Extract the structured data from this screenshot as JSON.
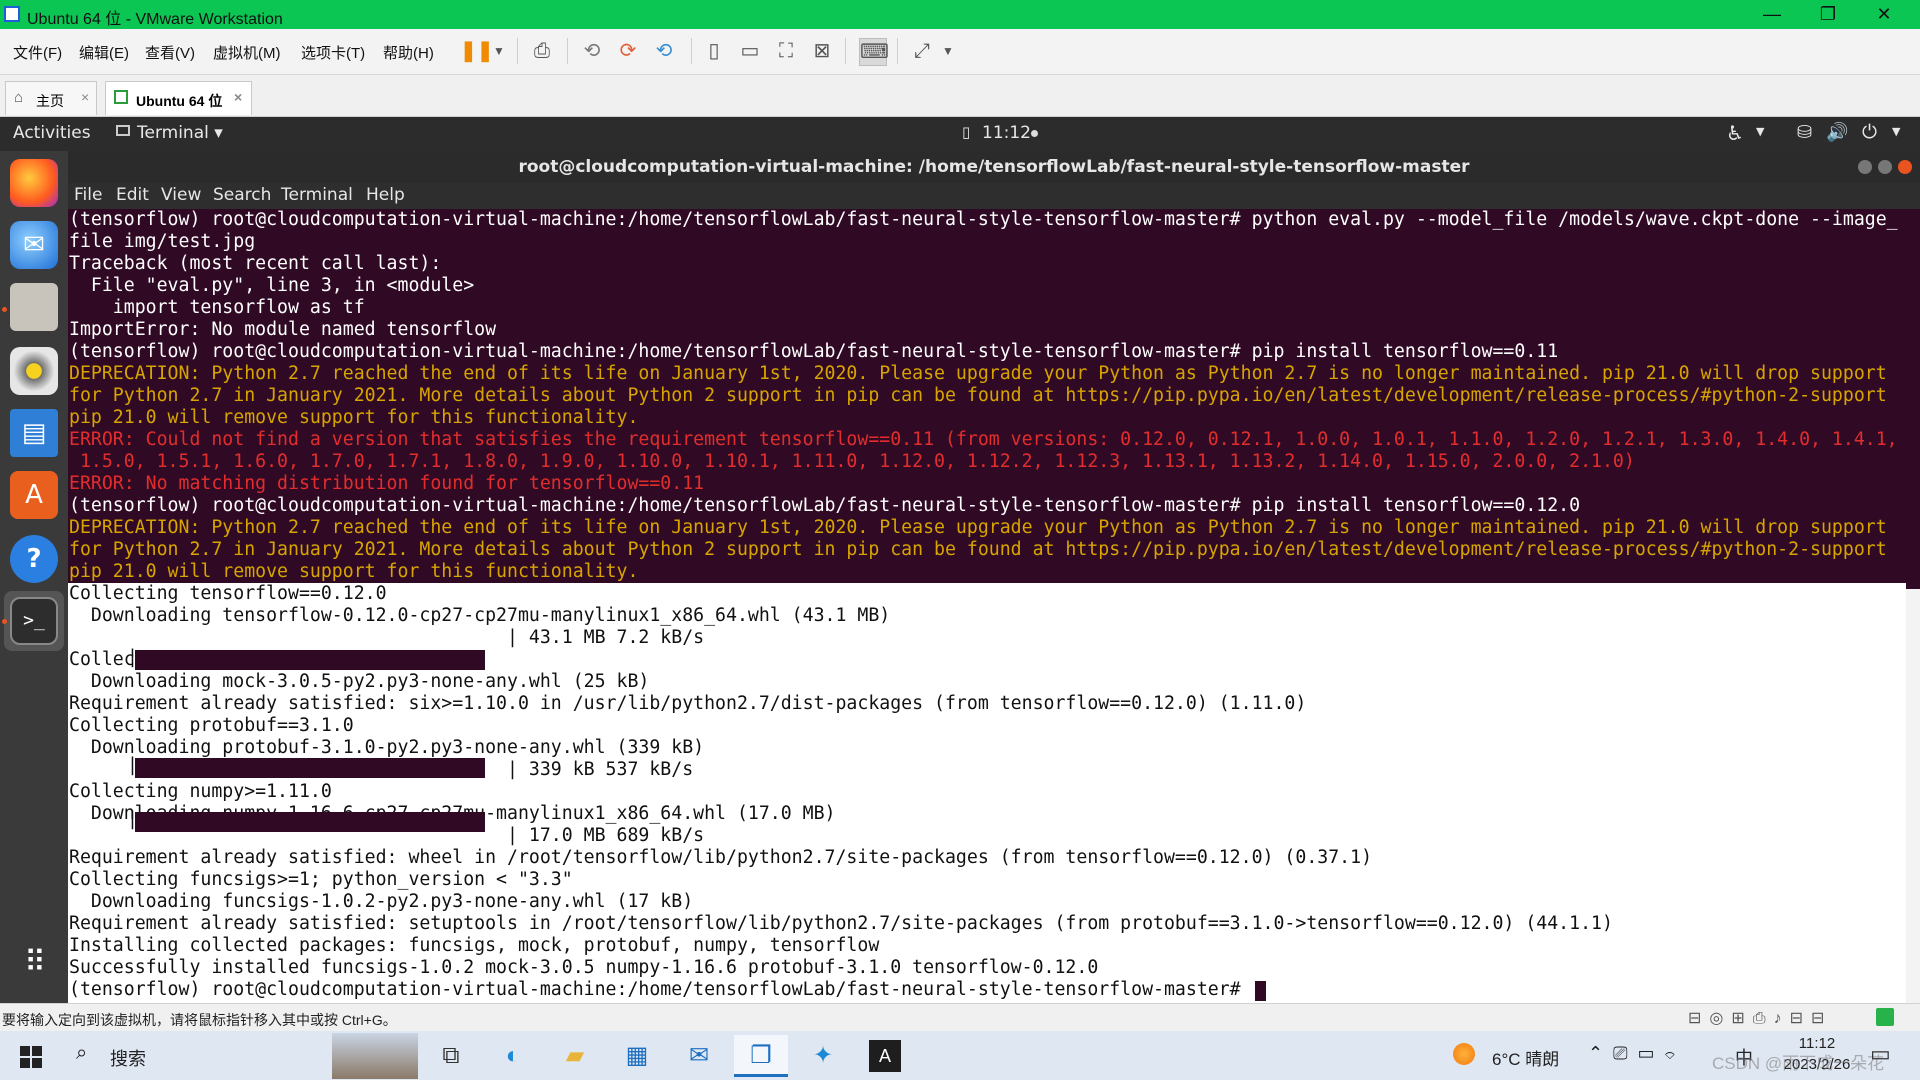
{
  "window": {
    "title": "Ubuntu 64 位 - VMware Workstation",
    "minimize": "—",
    "restore": "❐",
    "close": "✕"
  },
  "vm_menu": [
    "文件(F)",
    "编辑(E)",
    "查看(V)",
    "虚拟机(M)",
    "选项卡(T)",
    "帮助(H)"
  ],
  "vm_tabs": {
    "home": "主页",
    "vm": "Ubuntu 64 位",
    "close": "×"
  },
  "ubuntu_topbar": {
    "activities": "Activities",
    "app": "Terminal ▾",
    "clock": "11:12"
  },
  "terminal": {
    "title": "root@cloudcomputation-virtual-machine: /home/tensorflowLab/fast-neural-style-tensorflow-master",
    "menu": [
      "File",
      "Edit",
      "View",
      "Search",
      "Terminal",
      "Help"
    ],
    "lines": [
      "(tensorflow) root@cloudcomputation-virtual-machine:/home/tensorflowLab/fast-neural-style-tensorflow-master# python eval.py --model_file /models/wave.ckpt-done --image_",
      "file img/test.jpg",
      "Traceback (most recent call last):",
      "  File \"eval.py\", line 3, in <module>",
      "    import tensorflow as tf",
      "ImportError: No module named tensorflow",
      "(tensorflow) root@cloudcomputation-virtual-machine:/home/tensorflowLab/fast-neural-style-tensorflow-master# pip install tensorflow==0.11",
      "DEPRECATION: Python 2.7 reached the end of its life on January 1st, 2020. Please upgrade your Python as Python 2.7 is no longer maintained. pip 21.0 will drop support",
      "for Python 2.7 in January 2021. More details about Python 2 support in pip can be found at https://pip.pypa.io/en/latest/development/release-process/#python-2-support",
      "pip 21.0 will remove support for this functionality.",
      "ERROR: Could not find a version that satisfies the requirement tensorflow==0.11 (from versions: 0.12.0, 0.12.1, 1.0.0, 1.0.1, 1.1.0, 1.2.0, 1.2.1, 1.3.0, 1.4.0, 1.4.1,",
      " 1.5.0, 1.5.1, 1.6.0, 1.7.0, 1.7.1, 1.8.0, 1.9.0, 1.10.0, 1.10.1, 1.11.0, 1.12.0, 1.12.2, 1.12.3, 1.13.1, 1.13.2, 1.14.0, 1.15.0, 2.0.0, 2.1.0)",
      "ERROR: No matching distribution found for tensorflow==0.11",
      "(tensorflow) root@cloudcomputation-virtual-machine:/home/tensorflowLab/fast-neural-style-tensorflow-master# pip install tensorflow==0.12.0",
      "DEPRECATION: Python 2.7 reached the end of its life on January 1st, 2020. Please upgrade your Python as Python 2.7 is no longer maintained. pip 21.0 will drop support",
      "for Python 2.7 in January 2021. More details about Python 2 support in pip can be found at https://pip.pypa.io/en/latest/development/release-process/#python-2-support",
      "pip 21.0 will remove support for this functionality.",
      "Collecting tensorflow==0.12.0",
      "  Downloading tensorflow-0.12.0-cp27-cp27mu-manylinux1_x86_64.whl (43.1 MB)",
      "                                        | 43.1 MB 7.2 kB/s",
      "Collecting mock>=2.0.0",
      "  Downloading mock-3.0.5-py2.py3-none-any.whl (25 kB)",
      "Requirement already satisfied: six>=1.10.0 in /usr/lib/python2.7/dist-packages (from tensorflow==0.12.0) (1.11.0)",
      "Collecting protobuf==3.1.0",
      "  Downloading protobuf-3.1.0-py2.py3-none-any.whl (339 kB)",
      "                                        | 339 kB 537 kB/s",
      "Collecting numpy>=1.11.0",
      "  Downloading numpy-1.16.6-cp27-cp27mu-manylinux1_x86_64.whl (17.0 MB)",
      "                                        | 17.0 MB 689 kB/s",
      "Requirement already satisfied: wheel in /root/tensorflow/lib/python2.7/site-packages (from tensorflow==0.12.0) (0.37.1)",
      "Collecting funcsigs>=1; python_version < \"3.3\"",
      "  Downloading funcsigs-1.0.2-py2.py3-none-any.whl (17 kB)",
      "Requirement already satisfied: setuptools in /root/tensorflow/lib/python2.7/site-packages (from protobuf==3.1.0->tensorflow==0.12.0) (44.1.1)",
      "Installing collected packages: funcsigs, mock, protobuf, numpy, tensorflow",
      "Successfully installed funcsigs-1.0.2 mock-3.0.5 numpy-1.16.6 protobuf-3.1.0 tensorflow-0.12.0",
      "(tensorflow) root@cloudcomputation-virtual-machine:/home/tensorflowLab/fast-neural-style-tensorflow-master# "
    ],
    "colors": {
      "background": "#300a24",
      "text": "#ffffff",
      "warning": "#d7a400",
      "error": "#e32d2d",
      "selection_bg": "#ffffff"
    },
    "progress": [
      1.0,
      1.0,
      1.0
    ]
  },
  "vm_status": {
    "hint": "要将输入定向到该虚拟机，请将鼠标指针移入其中或按 Ctrl+G。"
  },
  "taskbar": {
    "search": "搜索",
    "weather": "6°C 晴朗",
    "ime": "中",
    "time": "11:12",
    "date": "2023/2/26",
    "watermark": "CSDN @雨下成一朵花"
  }
}
